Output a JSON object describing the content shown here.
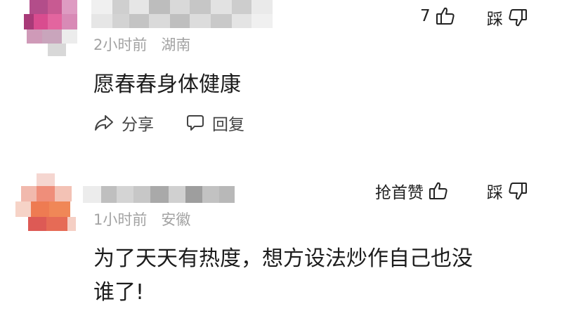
{
  "comments": [
    {
      "time": "2小时前",
      "location": "湖南",
      "text": "愿春春身体健康",
      "like_label": "7",
      "dislike_label": "踩",
      "share_label": "分享",
      "reply_label": "回复"
    },
    {
      "time": "1小时前",
      "location": "安徽",
      "text_line1": "为了天天有热度，想方设法炒作自己也没",
      "text_line2": "谁了!",
      "like_label": "抢首赞",
      "dislike_label": "踩"
    }
  ],
  "icons": {
    "like": "thumbs-up-icon",
    "dislike": "thumbs-down-icon",
    "share": "share-arrow-icon",
    "reply": "speech-bubble-icon"
  },
  "colors": {
    "meta_text": "#a3a3a3",
    "body_text": "#1c1c1c",
    "action_text": "#444444"
  }
}
